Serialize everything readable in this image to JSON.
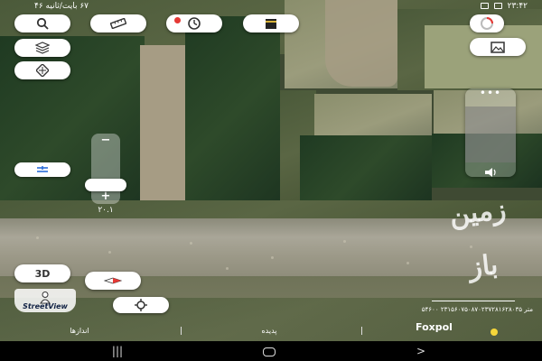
{
  "status_bar": {
    "left_text": "۶۷ بایت/ثانیه ۴۶",
    "time": "۲۳:۴۲"
  },
  "toolbar": {
    "search_icon": "search-icon",
    "ruler_icon": "ruler-icon",
    "history_icon": "history-icon",
    "kaaba_icon": "kaaba-icon",
    "layers_icon": "layers-icon",
    "grid_icon": "grid-icon",
    "compass_icon": "compass-icon",
    "image_icon": "image-icon",
    "measure_icon": "measure-icon"
  },
  "controls": {
    "three_d_label": "3D",
    "zoom_plus": "+",
    "zoom_minus": "−",
    "zoom_value": "۲۰.۱",
    "zoom_level_fraction": 0.3
  },
  "right_slider": {
    "handle_text": "•••",
    "sound_icon": "sound-icon"
  },
  "watermark": {
    "text": "زمین باز"
  },
  "street_view": {
    "label": "StreetView"
  },
  "info": {
    "scale_text": "۵۴۶۰۰ متر ۲۳۱۵۶۰۷۵۰۸۷۰۲۳۷۲۸۱۶۲۸۰۳۵",
    "foxpol": "Foxpol",
    "bottom_label_left": "اندازها",
    "bottom_label_center": "پدیده"
  },
  "colors": {
    "pill_bg": "#ffffff",
    "accent_red": "#e53935",
    "kaaba_gold": "#d7b23a"
  }
}
